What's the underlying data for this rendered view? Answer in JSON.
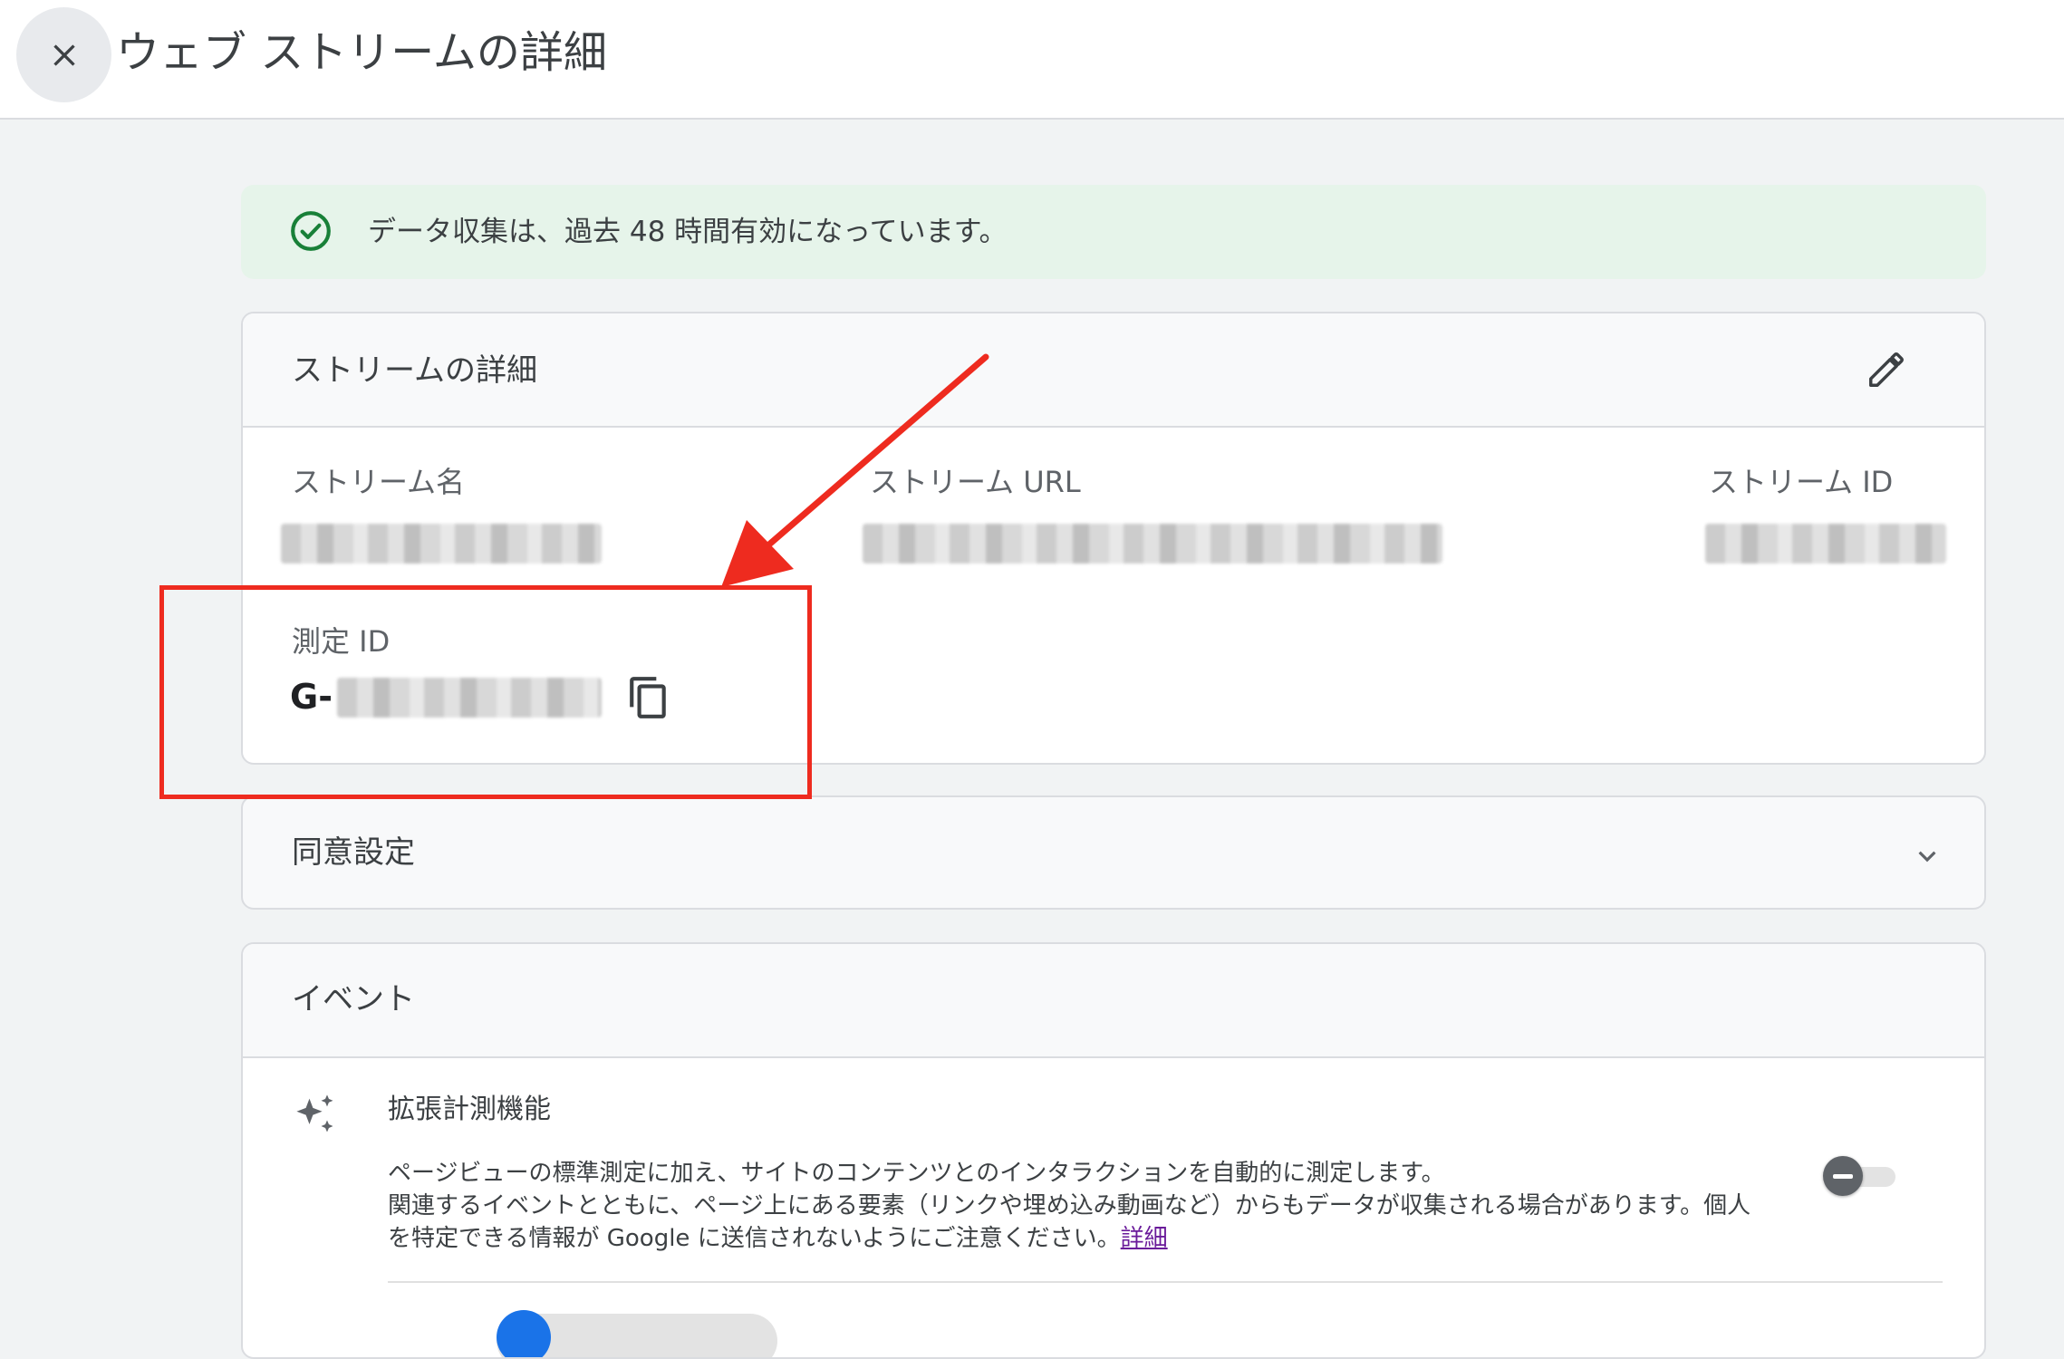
{
  "header": {
    "title": "ウェブ ストリームの詳細",
    "close_icon": "close-icon"
  },
  "banner": {
    "icon": "check-circle-icon",
    "text": "データ収集は、過去 48 時間有効になっています。"
  },
  "stream_details": {
    "title": "ストリームの詳細",
    "edit_icon": "pencil-icon",
    "fields": {
      "stream_name_label": "ストリーム名",
      "stream_url_label": "ストリーム URL",
      "stream_id_label": "ストリーム ID",
      "measurement_id_label": "測定 ID",
      "measurement_id_prefix": "G-"
    },
    "copy_icon": "copy-icon"
  },
  "consent": {
    "title": "同意設定",
    "expand_icon": "chevron-down-icon"
  },
  "events": {
    "title": "イベント",
    "enhanced": {
      "icon": "sparkle-icon",
      "title": "拡張計測機能",
      "description_line1": "ページビューの標準測定に加え、サイトのコンテンツとのインタラクションを自動的に測定します。",
      "description_line2": "関連するイベントとともに、ページ上にある要素（リンクや埋め込み動画など）からもデータが収集される場合があります。個人",
      "description_line3": "を特定できる情報が Google に送信されないようにご注意ください。",
      "learn_more": "詳細",
      "toggle_state": "off"
    }
  },
  "annotation": {
    "color": "#ee2b1f"
  }
}
